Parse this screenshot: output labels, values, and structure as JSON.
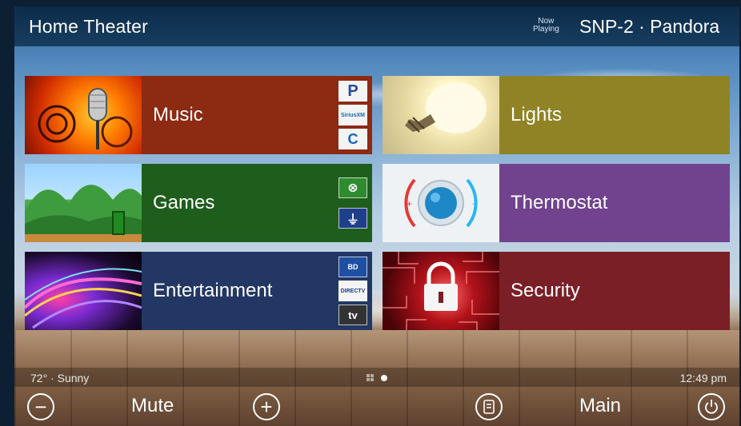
{
  "header": {
    "title": "Home Theater",
    "now_playing_label_1": "Now",
    "now_playing_label_2": "Playing",
    "now_playing_source": "SNP-2 · Pandora"
  },
  "tiles": [
    {
      "label": "Music",
      "image": "microphone-art",
      "badges": [
        "P",
        "SiriusXM",
        "C"
      ]
    },
    {
      "label": "Lights",
      "image": "light-bulb"
    },
    {
      "label": "Games",
      "image": "mario-landscape",
      "badges": [
        "xbox",
        "playstation"
      ]
    },
    {
      "label": "Thermostat",
      "image": "thermostat-dial",
      "plus": "+",
      "minus": "−"
    },
    {
      "label": "Entertainment",
      "image": "abstract-light-swirl",
      "badges": [
        "blu-ray",
        "DIRECTV",
        "tv"
      ]
    },
    {
      "label": "Security",
      "image": "circuit-padlock"
    }
  ],
  "status": {
    "weather": "72° · Sunny",
    "time": "12:49 pm"
  },
  "bottom": {
    "mute_label": "Mute",
    "main_label": "Main",
    "volume_down_symbol": "−",
    "volume_up_symbol": "+"
  },
  "colors": {
    "music": "#8c2a12",
    "games": "#1f5d1c",
    "entertainment": "#223764",
    "lights": "#8f8325",
    "thermostat": "#71438f",
    "security": "#7a1f26"
  }
}
